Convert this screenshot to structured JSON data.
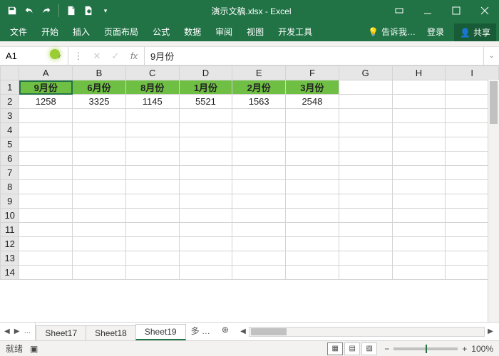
{
  "title": "演示文稿.xlsx - Excel",
  "ribbon": {
    "file": "文件",
    "home": "开始",
    "insert": "插入",
    "layout": "页面布局",
    "formulas": "公式",
    "data": "数据",
    "review": "审阅",
    "view": "视图",
    "dev": "开发工具",
    "tell": "告诉我…",
    "login": "登录",
    "share": "共享"
  },
  "namebox": "A1",
  "formula": "9月份",
  "columns": [
    "A",
    "B",
    "C",
    "D",
    "E",
    "F",
    "G",
    "H",
    "I"
  ],
  "rows_visible": 14,
  "chart_data": {
    "type": "table",
    "header_row": [
      "9月份",
      "6月份",
      "8月份",
      "1月份",
      "2月份",
      "3月份"
    ],
    "data_rows": [
      [
        1258,
        3325,
        1145,
        5521,
        1563,
        2548
      ]
    ]
  },
  "sheets": {
    "nav_more": "…",
    "items": [
      "Sheet17",
      "Sheet18",
      "Sheet19"
    ],
    "active": "Sheet19",
    "overflow": "多"
  },
  "status": {
    "ready": "就绪",
    "zoom_label": "100%"
  }
}
